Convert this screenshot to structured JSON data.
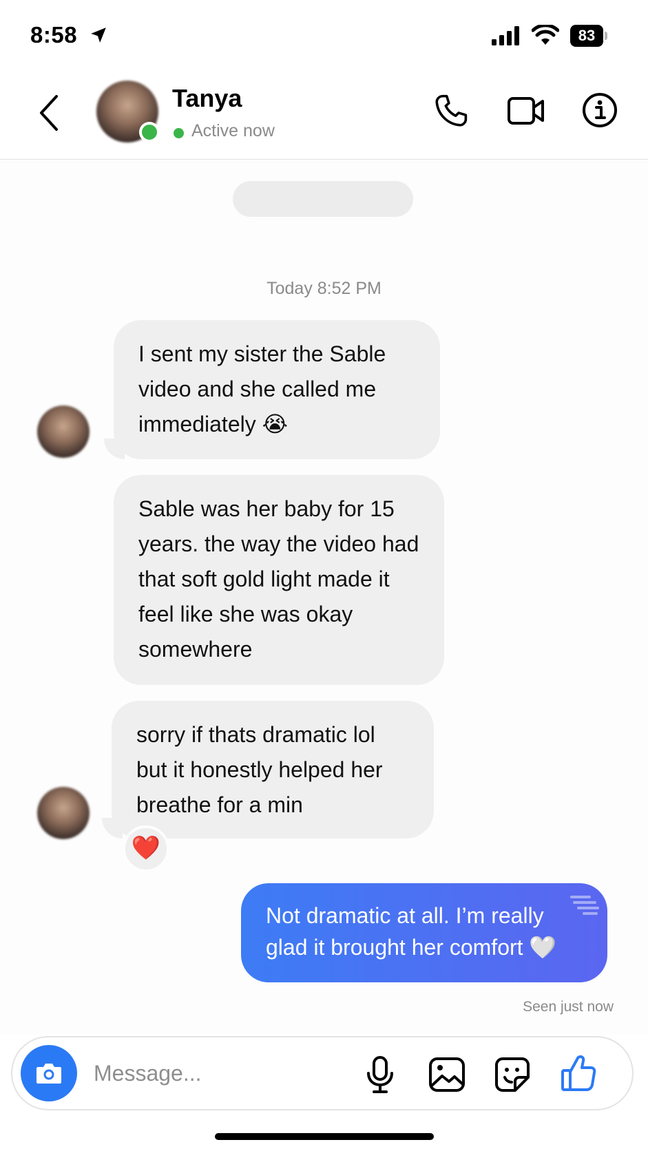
{
  "status_bar": {
    "time": "8:58",
    "battery": "83"
  },
  "header": {
    "contact_name": "Tanya",
    "status": "Active now"
  },
  "chat": {
    "timestamp": "Today 8:52 PM",
    "messages": [
      {
        "from": "Tanya",
        "text": "I sent my sister the Sable video and she called me immediately 😭"
      },
      {
        "from": "Tanya",
        "text": "Sable was her baby for 15 years. the way the video had that soft gold light made it feel like she was okay somewhere"
      },
      {
        "from": "Tanya",
        "text": "sorry if thats dramatic lol but it honestly helped her breathe for a min",
        "reaction": "❤️"
      },
      {
        "from": "me",
        "text": "Not dramatic at all. I’m really glad it brought her comfort 🤍"
      }
    ],
    "seen": "Seen just now"
  },
  "composer": {
    "placeholder": "Message..."
  },
  "colors": {
    "accent": "#2b7af5",
    "online": "#3ab54a",
    "bubble_in": "#efefef",
    "bubble_out_start": "#3d7cf5",
    "bubble_out_end": "#5b66f0"
  },
  "icons": [
    "location-arrow-icon",
    "signal-icon",
    "wifi-icon",
    "back-chevron-icon",
    "phone-icon",
    "video-icon",
    "info-icon",
    "camera-icon",
    "mic-icon",
    "gallery-icon",
    "sticker-icon",
    "like-icon"
  ]
}
